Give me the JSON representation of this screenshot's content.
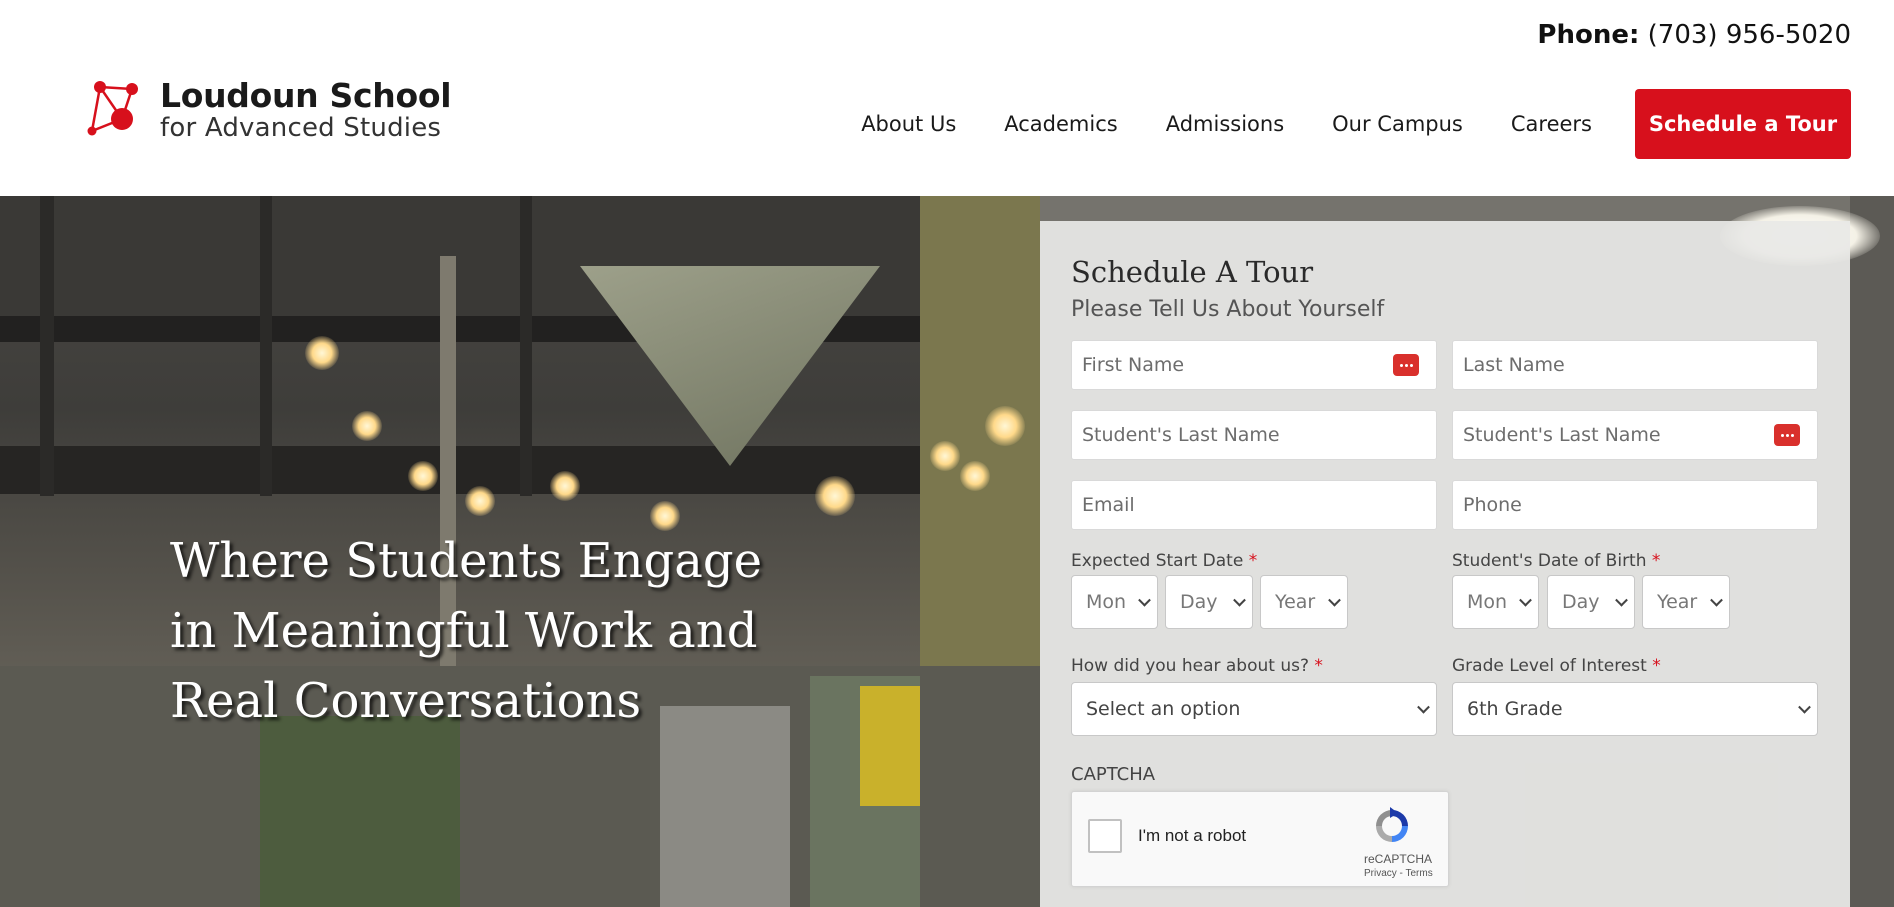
{
  "header": {
    "phone_label": "Phone:",
    "phone_number": "(703) 956-5020",
    "logo_line1": "Loudoun School",
    "logo_line2": "for Advanced Studies",
    "nav": [
      "About Us",
      "Academics",
      "Admissions",
      "Our Campus",
      "Careers"
    ],
    "cta": "Schedule a Tour",
    "brand_color": "#d7101c"
  },
  "hero": {
    "headline_line1": "Where Students Engage",
    "headline_line2": "in Meaningful Work and",
    "headline_line3": "Real Conversations"
  },
  "form": {
    "title": "Schedule A Tour",
    "subtitle": "Please Tell Us About Yourself",
    "first_name_placeholder": "First Name",
    "last_name_placeholder": "Last Name",
    "student_first_placeholder": "Student's Last Name",
    "student_last_placeholder": "Student's Last Name",
    "email_placeholder": "Email",
    "phone_placeholder": "Phone",
    "start_date_label": "Expected Start Date",
    "dob_label": "Student's Date of Birth",
    "required_mark": "*",
    "month": "Mon",
    "day": "Day",
    "year": "Year",
    "hear_label": "How did you hear about us?",
    "hear_value": "Select an option",
    "grade_label": "Grade Level of Interest",
    "grade_value": "6th Grade",
    "captcha_label": "CAPTCHA",
    "captcha_text": "I'm not a robot",
    "recaptcha_name": "reCAPTCHA",
    "recaptcha_links": "Privacy - Terms"
  }
}
